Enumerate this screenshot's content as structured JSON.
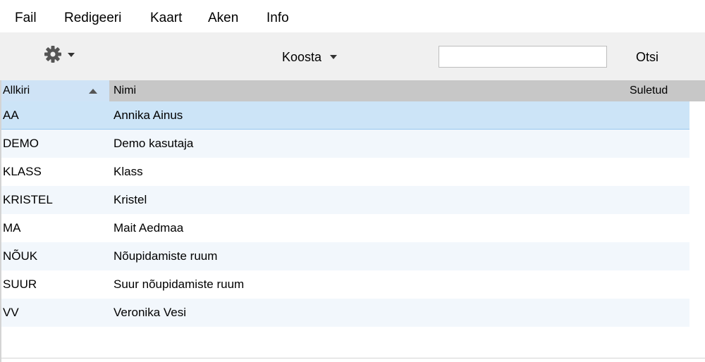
{
  "menu": [
    "Fail",
    "Redigeeri",
    "Kaart",
    "Aken",
    "Info"
  ],
  "toolbar": {
    "settings_icon": "gear-icon",
    "compose_label": "Koosta",
    "search_value": "",
    "search_label": "Otsi"
  },
  "table": {
    "columns": [
      "Allkiri",
      "Nimi",
      "Suletud"
    ],
    "sort_column": "Allkiri",
    "sort_direction": "ascending",
    "rows": [
      {
        "allkiri": "AA",
        "nimi": "Annika Ainus",
        "suletud": ""
      },
      {
        "allkiri": "DEMO",
        "nimi": "Demo kasutaja",
        "suletud": ""
      },
      {
        "allkiri": "KLASS",
        "nimi": "Klass",
        "suletud": ""
      },
      {
        "allkiri": "KRISTEL",
        "nimi": "Kristel",
        "suletud": ""
      },
      {
        "allkiri": "MA",
        "nimi": "Mait Aedmaa",
        "suletud": ""
      },
      {
        "allkiri": "NÕUK",
        "nimi": "Nõupidamiste ruum",
        "suletud": ""
      },
      {
        "allkiri": "SUUR",
        "nimi": "Suur nõupidamiste ruum",
        "suletud": ""
      },
      {
        "allkiri": "VV",
        "nimi": "Veronika Vesi",
        "suletud": ""
      }
    ]
  },
  "colors": {
    "selected_row": "#cce4f7",
    "alt_row": "#f2f7fc",
    "header": "#c7c7c7",
    "sorted_header": "#cfe3f6",
    "toolbar": "#f0f0f0"
  }
}
